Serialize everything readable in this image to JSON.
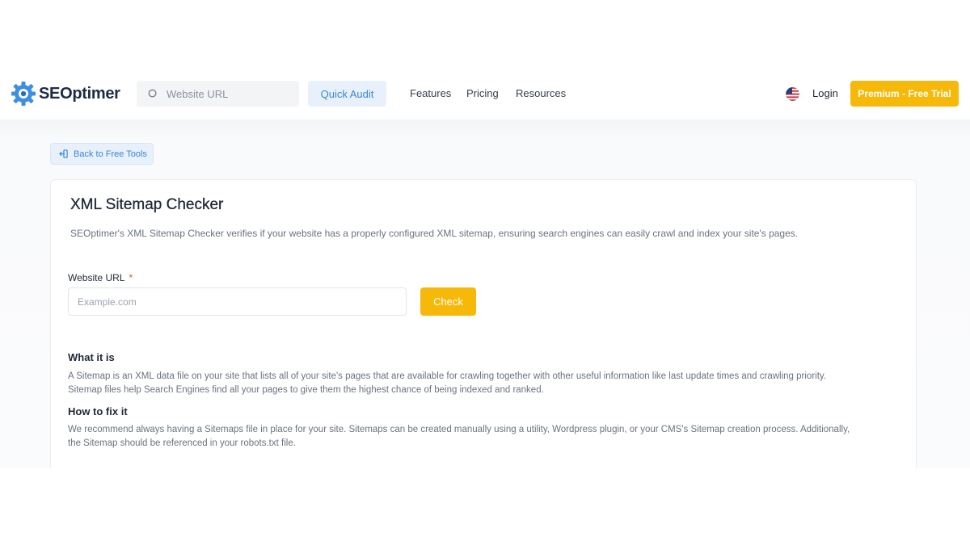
{
  "header": {
    "logo_text": "SEOptimer",
    "search_placeholder": "Website URL",
    "quick_audit_label": "Quick Audit",
    "nav": [
      "Features",
      "Pricing",
      "Resources"
    ],
    "login_label": "Login",
    "premium_label": "Premium - Free Trial"
  },
  "back_button_label": "Back to Free Tools",
  "tool": {
    "title": "XML Sitemap Checker",
    "description": "SEOptimer's XML Sitemap Checker verifies if your website has a properly configured XML sitemap, ensuring search engines can easily crawl and index your site's pages.",
    "field_label": "Website URL",
    "required_marker": "*",
    "input_placeholder": "Example.com",
    "check_label": "Check"
  },
  "sections": {
    "what_heading": "What it is",
    "what_line1": "A Sitemap is an XML data file on your site that lists all of your site's pages that are available for crawling together with other useful information like last update times and crawling priority.",
    "what_line2": "Sitemap files help Search Engines find all your pages to give them the highest chance of being indexed and ranked.",
    "fix_heading": "How to fix it",
    "fix_line1": "We recommend always having a Sitemaps file in place for your site. Sitemaps can be created manually using a utility, Wordpress plugin, or your CMS's Sitemap creation process. Additionally,",
    "fix_line2": "the Sitemap should be referenced in your robots.txt file."
  },
  "colors": {
    "accent_yellow": "#f6b90a",
    "accent_blue": "#3a86d6",
    "light_blue_bg": "#e8f1fb",
    "required_red": "#e24b4b"
  },
  "icons": {
    "logo": "gear-logo-icon",
    "search": "search-icon",
    "flag": "us-flag-icon",
    "back": "back-arrow-icon"
  }
}
